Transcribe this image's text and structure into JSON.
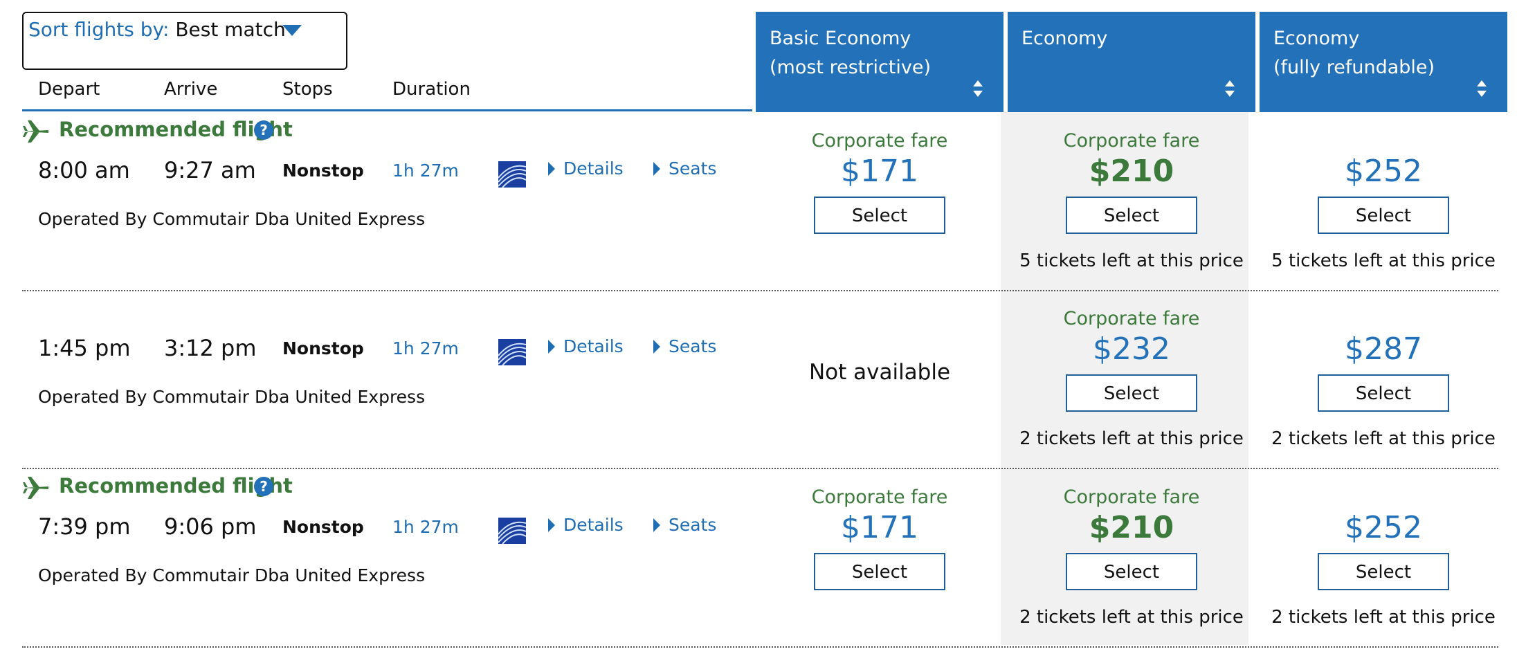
{
  "sort": {
    "label": "Sort flights by:",
    "value": "Best match"
  },
  "columns": {
    "depart": "Depart",
    "arrive": "Arrive",
    "stops": "Stops",
    "duration": "Duration"
  },
  "fare_headers": [
    {
      "line1": "Basic Economy",
      "line2": "(most restrictive)"
    },
    {
      "line1": "Economy",
      "line2": ""
    },
    {
      "line1": "Economy",
      "line2": "(fully refundable)"
    }
  ],
  "labels": {
    "recommended": "Recommended flight",
    "help": "?",
    "details": "Details",
    "seats": "Seats",
    "corporate_fare": "Corporate fare",
    "select": "Select",
    "not_available": "Not available"
  },
  "flights": [
    {
      "depart": "8:00 am",
      "arrive": "9:27 am",
      "stops": "Nonstop",
      "duration": "1h 27m",
      "operated": "Operated By Commutair Dba United Express",
      "basic": {
        "price": "$171"
      },
      "economy": {
        "price": "$210",
        "left": "5 tickets left at this price"
      },
      "refundable": {
        "price": "$252",
        "left": "5 tickets left at this price"
      }
    },
    {
      "depart": "1:45 pm",
      "arrive": "3:12 pm",
      "stops": "Nonstop",
      "duration": "1h 27m",
      "operated": "Operated By Commutair Dba United Express",
      "economy": {
        "price": "$232",
        "left": "2 tickets left at this price"
      },
      "refundable": {
        "price": "$287",
        "left": "2 tickets left at this price"
      }
    },
    {
      "depart": "7:39 pm",
      "arrive": "9:06 pm",
      "stops": "Nonstop",
      "duration": "1h 27m",
      "operated": "Operated By Commutair Dba United Express",
      "basic": {
        "price": "$171"
      },
      "economy": {
        "price": "$210",
        "left": "2 tickets left at this price"
      },
      "refundable": {
        "price": "$252",
        "left": "2 tickets left at this price"
      }
    }
  ],
  "colors": {
    "brand_blue": "#2271b9",
    "recommend_green": "#3b7a3b",
    "economy_bg": "#f1f1f1"
  }
}
